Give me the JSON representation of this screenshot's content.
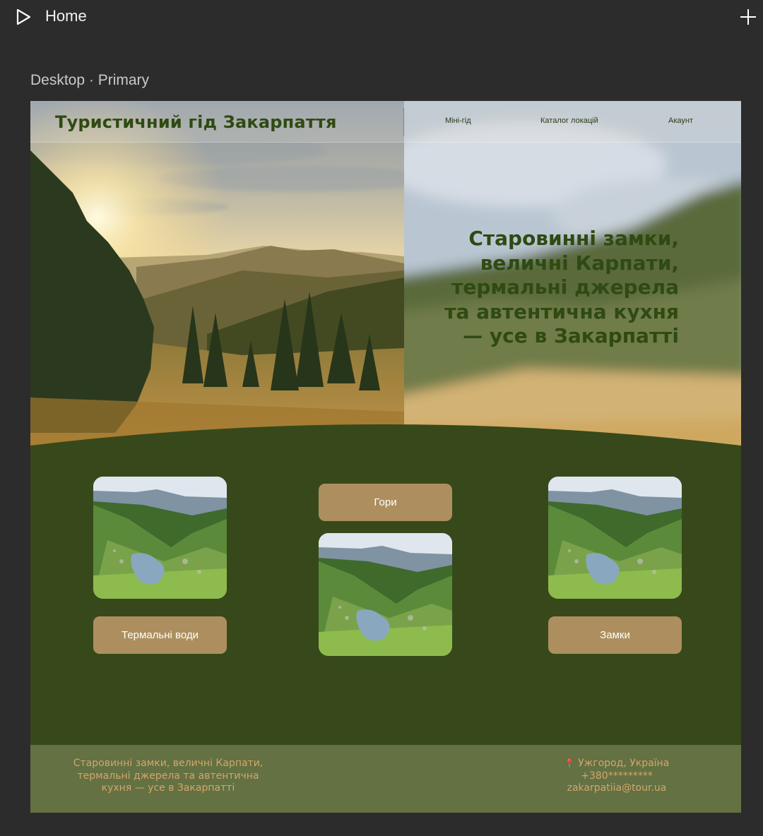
{
  "app": {
    "title": "Home"
  },
  "frame": {
    "label": "Desktop · Primary"
  },
  "site": {
    "title": "Туристичний гід Закарпаття",
    "nav": [
      "Міні-гід",
      "Каталог локацій",
      "Акаунт"
    ],
    "headline": "Старовинні замки,\nвеличні Карпати,\nтермальні джерела\nта автентична кухня\n— усе в Закарпатті"
  },
  "categories": {
    "mountains": "Гори",
    "thermal": "Термальні води",
    "castles": "Замки"
  },
  "footer": {
    "tagline": "Старовинні замки, величні Карпати,\nтермальні джерела та автентична\nкухня — усе в Закарпатті",
    "location": "Ужгород, Україна",
    "phone": "+380*********",
    "email": "zakarpatiia@tour.ua"
  },
  "colors": {
    "frame_bg": "#37491b",
    "button": "#ad8f5f",
    "footer_bg": "#637143",
    "footer_text": "#d4a66b",
    "headline": "#2f4a12"
  },
  "icons": {
    "play": "play-icon",
    "add": "plus-icon",
    "pin": "map-pin-icon"
  }
}
